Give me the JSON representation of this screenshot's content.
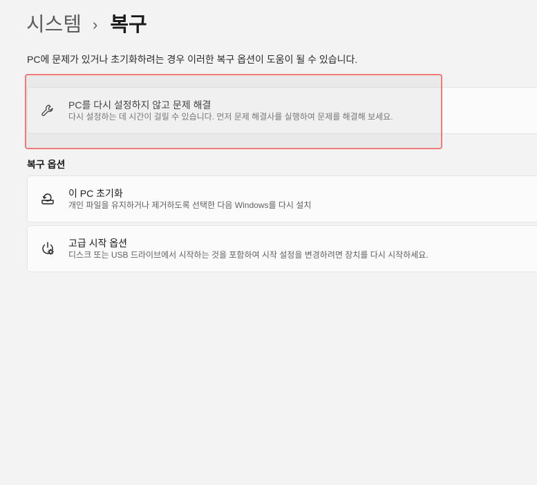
{
  "breadcrumb": {
    "parent": "시스템",
    "separator": "›",
    "current": "복구"
  },
  "description": "PC에 문제가 있거나 초기화하려는 경우 이러한 복구 옵션이 도움이 될 수 있습니다.",
  "troubleshoot_card": {
    "icon": "wrench-icon",
    "title": "PC를 다시 설정하지 않고 문제 해결",
    "subtitle": "다시 설정하는 데 시간이 걸릴 수 있습니다. 먼저 문제 해결사를 실행하여 문제를 해결해 보세요."
  },
  "recovery_options": {
    "heading": "복구 옵션",
    "items": [
      {
        "icon": "reset-pc-icon",
        "title": "이 PC 초기화",
        "subtitle": "개인 파일을 유지하거나 제거하도록 선택한 다음 Windows를 다시 설치"
      },
      {
        "icon": "advanced-startup-icon",
        "title": "고급 시작 옵션",
        "subtitle": "디스크 또는 USB 드라이브에서 시작하는 것을 포함하여 시작 설정을 변경하려면 장치를 다시 시작하세요."
      }
    ]
  },
  "colors": {
    "background": "#f3f3f3",
    "card": "#fbfbfb",
    "highlight_border": "#f07a7a"
  }
}
